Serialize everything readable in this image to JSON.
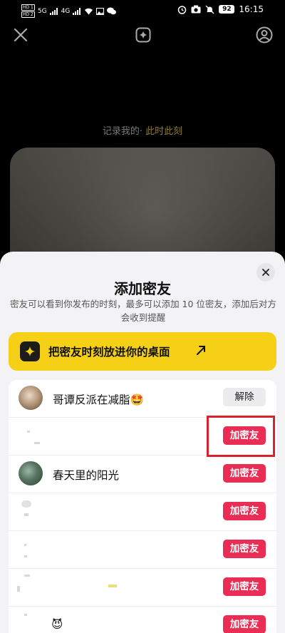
{
  "status_bar": {
    "left_tags": [
      "HD 1",
      "HD 2"
    ],
    "network_labels": [
      "5G",
      "4G"
    ],
    "battery": "92",
    "time": "16:15"
  },
  "top_bar": {
    "icons": [
      "close-icon",
      "sparkle-icon",
      "profile-icon"
    ]
  },
  "record_label": {
    "prefix": "记录我的",
    "accent": "· 此时此刻"
  },
  "sheet": {
    "title": "添加密友",
    "description": "密友可以看到你发布的时刻，最多可以添加 10 位密友，添加后对方会收到提醒",
    "cta_label": "把密友时刻放进你的桌面"
  },
  "friends": [
    {
      "name": "哥谭反派在减脂🤩",
      "action": "解除",
      "added": true
    },
    {
      "name": "",
      "action": "加密友",
      "added": false
    },
    {
      "name": "春天里的阳光",
      "action": "加密友",
      "added": false
    },
    {
      "name": "",
      "action": "加密友",
      "added": false
    },
    {
      "name": "",
      "action": "加密友",
      "added": false
    },
    {
      "name": "",
      "action": "加密友",
      "added": false
    },
    {
      "name": "😈",
      "action": "加密友",
      "added": false
    }
  ],
  "colors": {
    "accent_yellow": "#f5d016",
    "add_button_red": "#ea2d54",
    "annotation_red": "#d8232a"
  }
}
